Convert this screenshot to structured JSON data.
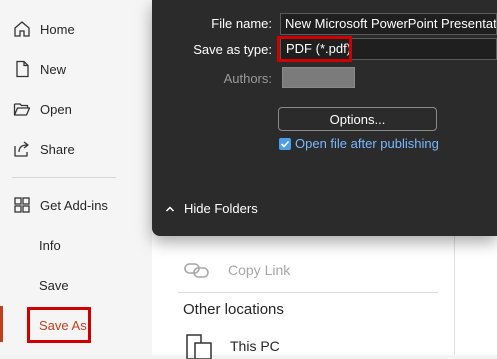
{
  "sidebar": {
    "items": [
      {
        "label": "Home",
        "icon": "home-icon"
      },
      {
        "label": "New",
        "icon": "new-document-icon"
      },
      {
        "label": "Open",
        "icon": "folder-open-icon"
      },
      {
        "label": "Share",
        "icon": "share-icon"
      },
      {
        "label": "Get Add-ins",
        "icon": "add-ins-icon"
      },
      {
        "label": "Info"
      },
      {
        "label": "Save"
      },
      {
        "label": "Save As"
      }
    ],
    "accent_color": "#c43e1c",
    "highlight_color": "#d10000"
  },
  "main": {
    "copy_link_label": "Copy Link",
    "other_locations_heading": "Other locations",
    "this_pc_label": "This PC"
  },
  "dialog": {
    "file_name_label": "File name:",
    "file_name_value": "New Microsoft PowerPoint Presentation.",
    "save_as_type_label": "Save as type:",
    "save_as_type_value": "PDF (*.pdf)",
    "authors_label": "Authors:",
    "options_button": "Options...",
    "open_after_publishing_label": "Open file after publishing",
    "open_after_publishing_checked": true,
    "hide_folders_label": "Hide Folders",
    "background_color": "#2b2b2b",
    "link_color": "#79b8ff"
  }
}
